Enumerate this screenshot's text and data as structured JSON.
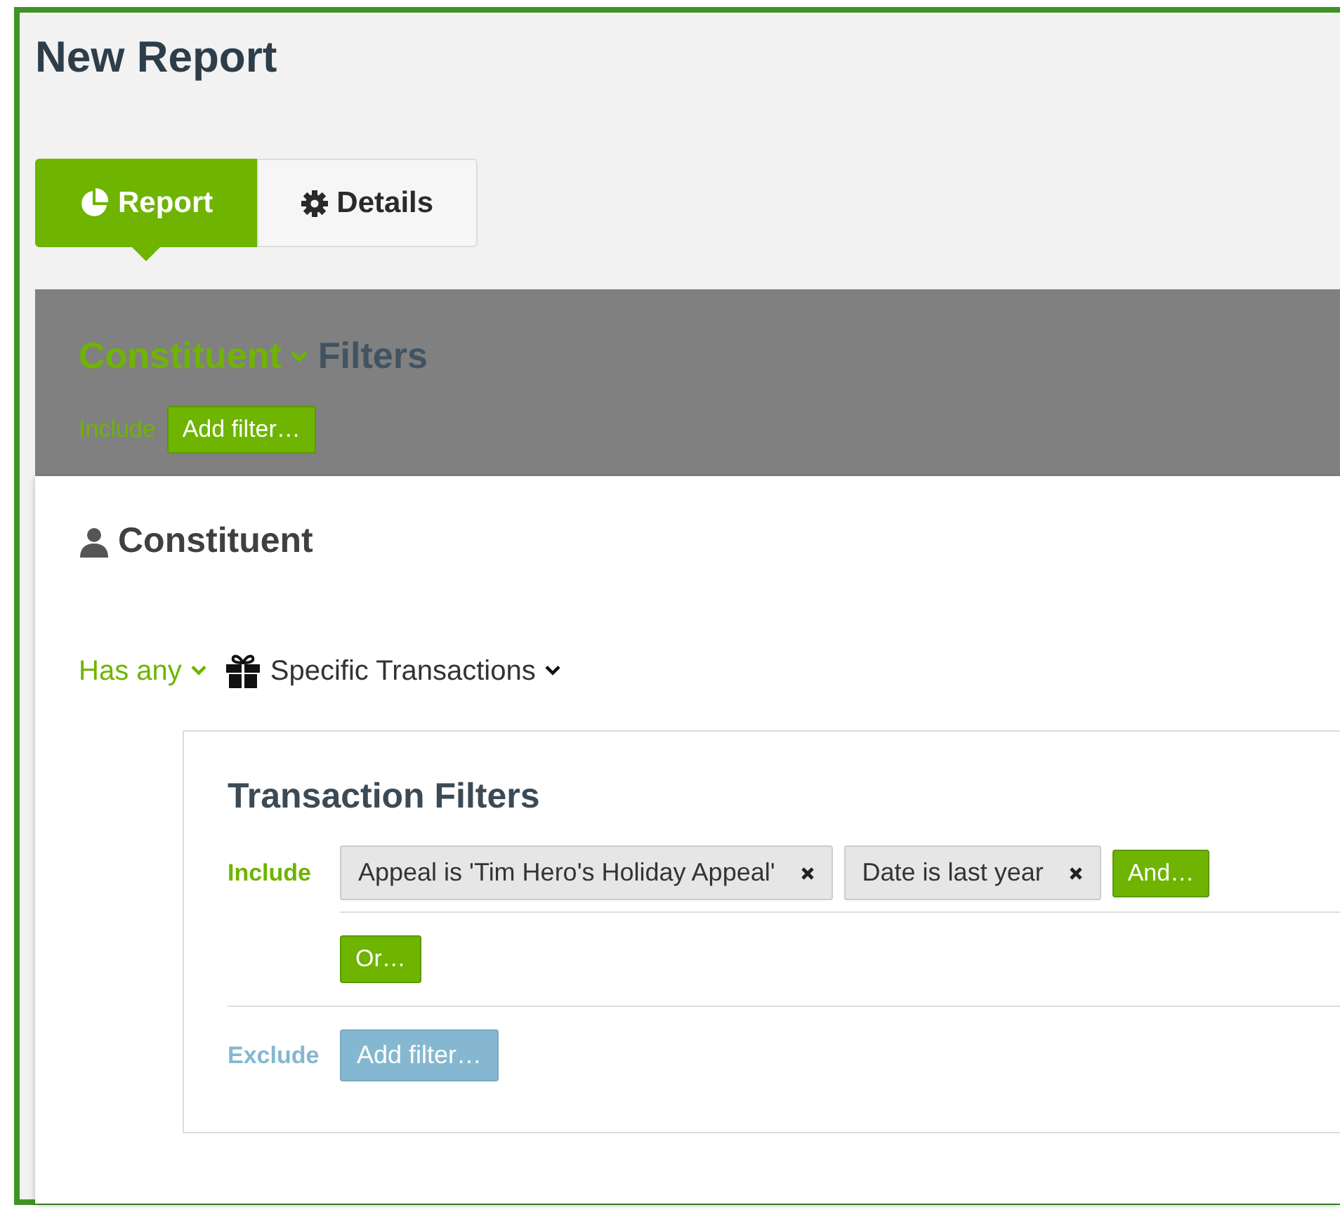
{
  "title": "New Report",
  "tabs": [
    {
      "label": "Report",
      "selected": true
    },
    {
      "label": "Details",
      "selected": false
    }
  ],
  "filters_bar": {
    "entity": "Constituent",
    "heading": "Filters",
    "include_label": "Include",
    "add_button": "Add filter…"
  },
  "card": {
    "title": "Constituent",
    "quantifier": "Has any",
    "target": "Specific Transactions",
    "panel": {
      "title": "Transaction Filters",
      "include_label": "Include",
      "chips": [
        {
          "label": "Appeal is 'Tim Hero's Holiday Appeal'"
        },
        {
          "label": "Date is last year"
        }
      ],
      "and_button": "And…",
      "or_button": "Or…",
      "exclude_label": "Exclude",
      "exclude_button": "Add filter…"
    }
  }
}
